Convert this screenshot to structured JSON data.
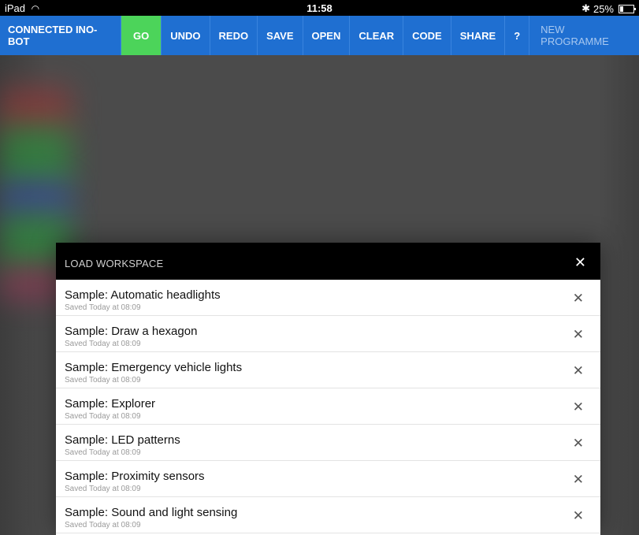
{
  "status_bar": {
    "device": "iPad",
    "time": "11:58",
    "battery": "25%"
  },
  "toolbar": {
    "connected": "CONNECTED INO-BOT",
    "go": "GO",
    "undo": "UNDO",
    "redo": "REDO",
    "save": "SAVE",
    "open": "OPEN",
    "clear": "CLEAR",
    "code": "CODE",
    "share": "SHARE",
    "help": "?",
    "new_programme": "NEW PROGRAMME"
  },
  "colors": {
    "toolbar": "#1f6fd1",
    "go": "#4cd45a",
    "modal_header": "#000000"
  },
  "modal": {
    "title": "LOAD WORKSPACE",
    "close_icon": "close-icon",
    "items": [
      {
        "title": "Sample: Automatic headlights",
        "subtitle": "Saved Today at 08:09"
      },
      {
        "title": "Sample: Draw a hexagon",
        "subtitle": "Saved Today at 08:09"
      },
      {
        "title": "Sample: Emergency vehicle lights",
        "subtitle": "Saved Today at 08:09"
      },
      {
        "title": "Sample: Explorer",
        "subtitle": "Saved Today at 08:09"
      },
      {
        "title": "Sample: LED patterns",
        "subtitle": "Saved Today at 08:09"
      },
      {
        "title": "Sample: Proximity sensors",
        "subtitle": "Saved Today at 08:09"
      },
      {
        "title": "Sample: Sound and light sensing",
        "subtitle": "Saved Today at 08:09"
      }
    ]
  }
}
